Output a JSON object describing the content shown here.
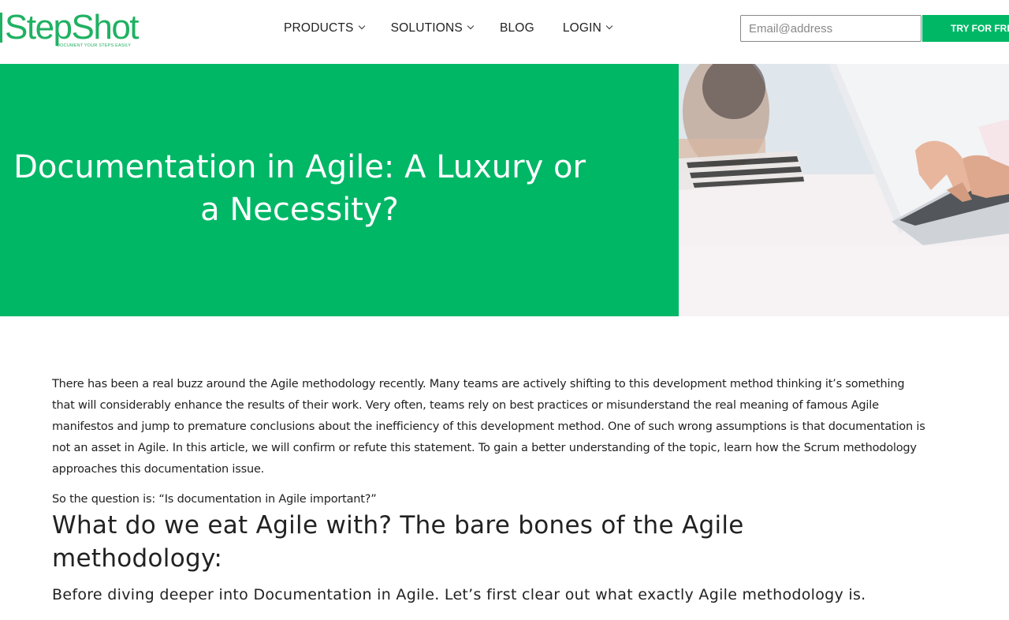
{
  "header": {
    "logo_text": "StepShot",
    "logo_tagline": "DOCUMENT YOUR STEPS EASILY",
    "nav": [
      {
        "label": "PRODUCTS",
        "dropdown": true
      },
      {
        "label": "SOLUTIONS",
        "dropdown": true
      },
      {
        "label": "BLOG",
        "dropdown": false
      },
      {
        "label": "LOGIN",
        "dropdown": true
      }
    ],
    "email_placeholder": "Email@address",
    "try_button": "TRY FOR FREE"
  },
  "hero": {
    "title": "Documentation in Agile: A Luxury or a Necessity?",
    "accent_color": "#00b766"
  },
  "article": {
    "intro": "There has been a real buzz around the Agile methodology recently. Many teams are actively shifting to this development method thinking it’s something that will considerably enhance the results of their work. Very often, teams rely on best practices or misunderstand the real meaning of famous Agile manifestos and jump to premature conclusions about the inefficiency of this development method. One of such wrong assumptions is that documentation is not an asset in Agile. In this article, we will confirm or refute this statement. To gain a better understanding of the topic, learn how the Scrum methodology approaches this documentation issue.",
    "question": "So the question is: “Is documentation in Agile important?”",
    "heading": "What do we eat Agile with? The bare bones of the Agile methodology:",
    "subheading": "Before diving deeper into Documentation in Agile. Let’s first clear out what exactly Agile methodology is."
  }
}
